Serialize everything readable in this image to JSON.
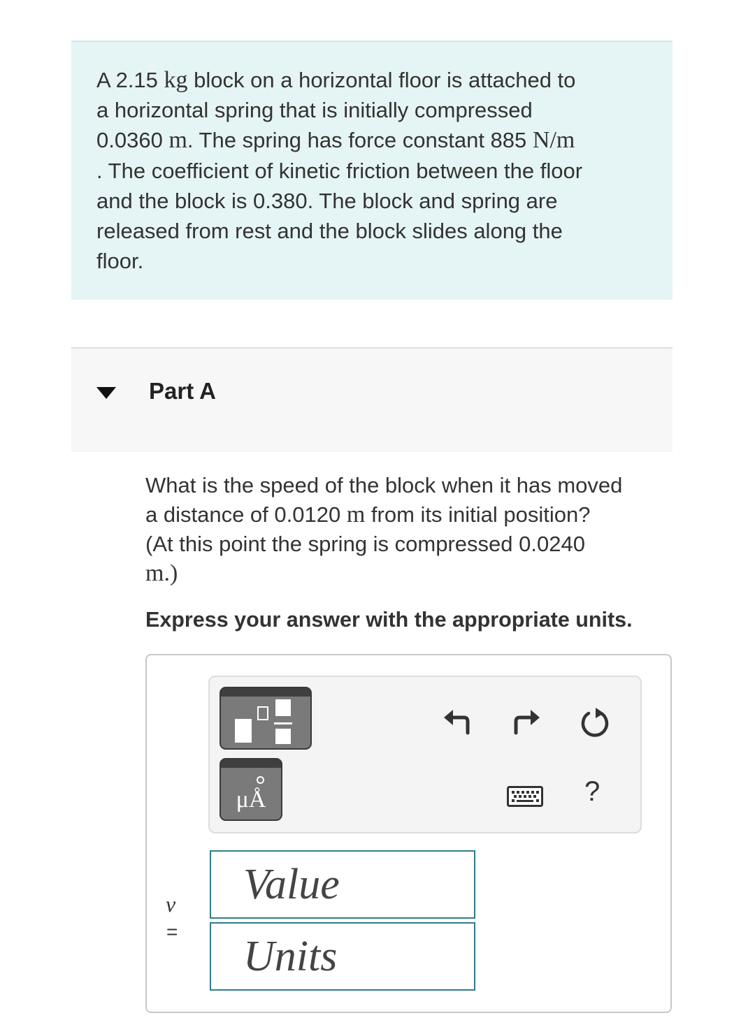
{
  "problem": {
    "line1_a": "A 2.15 ",
    "line1_unit": "kg",
    "line1_b": " block on a horizontal floor is attached to",
    "line2": "a horizontal spring that is initially compressed",
    "line3_a": "0.0360 ",
    "line3_unit": "m",
    "line3_b": ". The spring has force constant 885 ",
    "line3_unit2": "N/m",
    "line4": ". The coefficient of kinetic friction between the floor",
    "line5": "and the block is 0.380. The block and spring are",
    "line6": "released from rest and the block slides along the",
    "line7": "floor."
  },
  "part": {
    "title": "Part A"
  },
  "question": {
    "line1": "What is the speed of the block when it has moved",
    "line2_a": "a distance of 0.0120 ",
    "line2_unit": "m",
    "line2_b": " from its initial position?",
    "line3": "(At this point the spring is compressed 0.0240",
    "line4_unit": "m",
    "line4_b": ".)"
  },
  "instruction": "Express your answer with the appropriate units.",
  "answer": {
    "variable": "v",
    "equals": "=",
    "units_button_label": "μÅ",
    "help_label": "?",
    "value_placeholder": "Value",
    "units_placeholder": "Units"
  },
  "toolbar_icons": [
    "templates-icon",
    "units-icon",
    "undo-icon",
    "redo-icon",
    "reset-icon",
    "keyboard-icon",
    "help-icon"
  ],
  "colors": {
    "problem_bg": "#e5f4f4",
    "part_bg": "#f7f7f7",
    "field_border": "#2e7c8e"
  }
}
